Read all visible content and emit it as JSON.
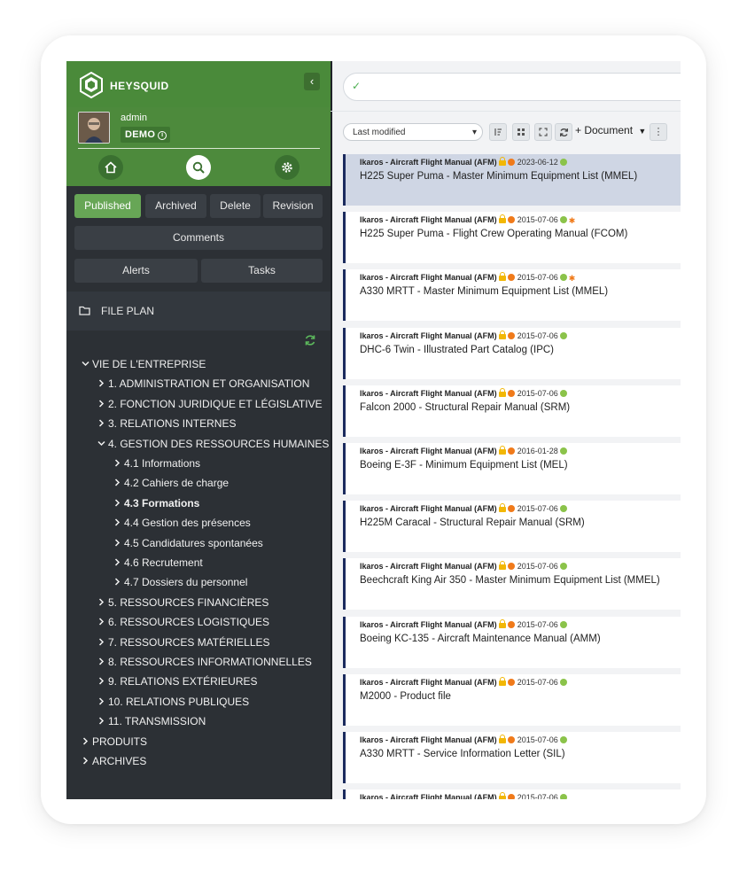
{
  "brand": {
    "name": "HEYSQUID"
  },
  "user": {
    "name": "admin",
    "role_badge": "DEMO"
  },
  "tabs": {
    "published": "Published",
    "archived": "Archived",
    "delete": "Delete",
    "revision": "Revision",
    "comments": "Comments",
    "alerts": "Alerts",
    "tasks": "Tasks"
  },
  "fileplan": {
    "label": "FILE PLAN"
  },
  "tree": [
    {
      "label": "VIE DE L'ENTREPRISE",
      "level": 0,
      "expanded": true
    },
    {
      "label": "1. ADMINISTRATION ET ORGANISATION",
      "level": 1
    },
    {
      "label": "2. FONCTION JURIDIQUE ET LÉGISLATIVE",
      "level": 1
    },
    {
      "label": "3. RELATIONS INTERNES",
      "level": 1
    },
    {
      "label": "4. GESTION DES RESSOURCES HUMAINES",
      "level": 1,
      "expanded": true
    },
    {
      "label": "4.1 Informations",
      "level": 2
    },
    {
      "label": "4.2 Cahiers de charge",
      "level": 2
    },
    {
      "label": "4.3 Formations",
      "level": 2,
      "bold": true
    },
    {
      "label": "4.4 Gestion des présences",
      "level": 2
    },
    {
      "label": "4.5 Candidatures spontanées",
      "level": 2
    },
    {
      "label": "4.6 Recrutement",
      "level": 2
    },
    {
      "label": "4.7 Dossiers du personnel",
      "level": 2
    },
    {
      "label": "5. RESSOURCES FINANCIÈRES",
      "level": 1
    },
    {
      "label": "6. RESSOURCES LOGISTIQUES",
      "level": 1
    },
    {
      "label": "7. RESSOURCES MATÉRIELLES",
      "level": 1
    },
    {
      "label": "8. RESSOURCES INFORMATIONNELLES",
      "level": 1
    },
    {
      "label": "9. RELATIONS EXTÉRIEURES",
      "level": 1
    },
    {
      "label": "10. RELATIONS PUBLIQUES",
      "level": 1
    },
    {
      "label": "11. TRANSMISSION",
      "level": 1
    },
    {
      "label": "PRODUITS",
      "level": 0
    },
    {
      "label": "ARCHIVES",
      "level": 0
    }
  ],
  "toolbar": {
    "sort_value": "Last modified",
    "add_document": "+ Document"
  },
  "documents": [
    {
      "category": "Ikaros - Aircraft Flight Manual (AFM)",
      "date": "2023-06-12",
      "title": "H225 Super Puma - Master Minimum Equipment List (MMEL)",
      "selected": true,
      "gear": false
    },
    {
      "category": "Ikaros - Aircraft Flight Manual (AFM)",
      "date": "2015-07-06",
      "title": "H225 Super Puma - Flight Crew Operating Manual (FCOM)",
      "gear": true
    },
    {
      "category": "Ikaros - Aircraft Flight Manual (AFM)",
      "date": "2015-07-06",
      "title": "A330 MRTT - Master Minimum Equipment List (MMEL)",
      "gear": true
    },
    {
      "category": "Ikaros - Aircraft Flight Manual (AFM)",
      "date": "2015-07-06",
      "title": "DHC-6 Twin - Illustrated Part Catalog (IPC)",
      "gear": false
    },
    {
      "category": "Ikaros - Aircraft Flight Manual (AFM)",
      "date": "2015-07-06",
      "title": "Falcon 2000 - Structural Repair Manual (SRM)",
      "gear": false
    },
    {
      "category": "Ikaros - Aircraft Flight Manual (AFM)",
      "date": "2016-01-28",
      "title": "Boeing E-3F - Minimum Equipment List (MEL)",
      "gear": false
    },
    {
      "category": "Ikaros - Aircraft Flight Manual (AFM)",
      "date": "2015-07-06",
      "title": "H225M Caracal - Structural Repair Manual (SRM)",
      "gear": false
    },
    {
      "category": "Ikaros - Aircraft Flight Manual (AFM)",
      "date": "2015-07-06",
      "title": "Beechcraft King Air 350 - Master Minimum Equipment List (MMEL)",
      "gear": false
    },
    {
      "category": "Ikaros - Aircraft Flight Manual (AFM)",
      "date": "2015-07-06",
      "title": "Boeing KC-135 - Aircraft Maintenance Manual (AMM)",
      "gear": false
    },
    {
      "category": "Ikaros - Aircraft Flight Manual (AFM)",
      "date": "2015-07-06",
      "title": "M2000 - Product file",
      "gear": false
    },
    {
      "category": "Ikaros - Aircraft Flight Manual (AFM)",
      "date": "2015-07-06",
      "title": "A330 MRTT - Service Information Letter (SIL)",
      "gear": false
    },
    {
      "category": "Ikaros - Aircraft Flight Manual (AFM)",
      "date": "2015-07-06",
      "title": "",
      "gear": false
    }
  ],
  "colors": {
    "brand_green": "#4d8a3c",
    "active_tab": "#67a656",
    "sidebar_bg": "#2c3035",
    "selected_row": "#cfd6e4",
    "row_accent": "#1b2b5e"
  }
}
